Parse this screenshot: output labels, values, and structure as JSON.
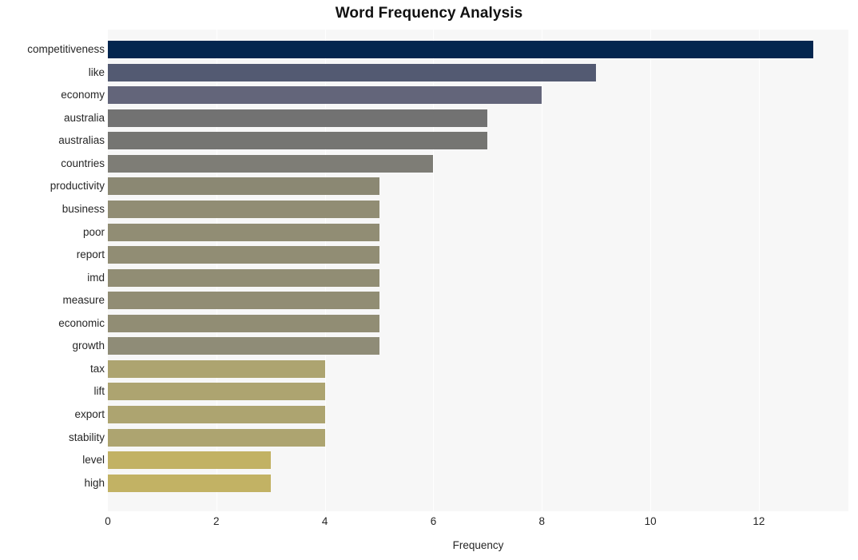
{
  "chart_data": {
    "type": "bar",
    "orientation": "horizontal",
    "title": "Word Frequency Analysis",
    "xlabel": "Frequency",
    "ylabel": "",
    "xlim": [
      0,
      13.65
    ],
    "xticks": [
      0,
      2,
      4,
      6,
      8,
      10,
      12
    ],
    "xtick_labels": [
      "0",
      "2",
      "4",
      "6",
      "8",
      "10",
      "12"
    ],
    "grid": "vertical-white-on-gray",
    "legend": "none",
    "categories": [
      "competitiveness",
      "like",
      "economy",
      "australia",
      "australias",
      "countries",
      "productivity",
      "business",
      "poor",
      "report",
      "imd",
      "measure",
      "economic",
      "growth",
      "tax",
      "lift",
      "export",
      "stability",
      "level",
      "high"
    ],
    "values": [
      13,
      9,
      8,
      7,
      7,
      6,
      5,
      5,
      5,
      5,
      5,
      5,
      5,
      5,
      4,
      4,
      4,
      4,
      3,
      3
    ],
    "colors": [
      "#04264f",
      "#535a72",
      "#63657a",
      "#727272",
      "#757572",
      "#7e7d76",
      "#8b8873",
      "#918d74",
      "#918d74",
      "#918d74",
      "#918d74",
      "#918d74",
      "#918d74",
      "#8f8c77",
      "#ada470",
      "#ada470",
      "#ada470",
      "#ada470",
      "#c2b264",
      "#c2b264"
    ],
    "plot_background": "#f7f7f7",
    "figure_background": "#ffffff"
  }
}
